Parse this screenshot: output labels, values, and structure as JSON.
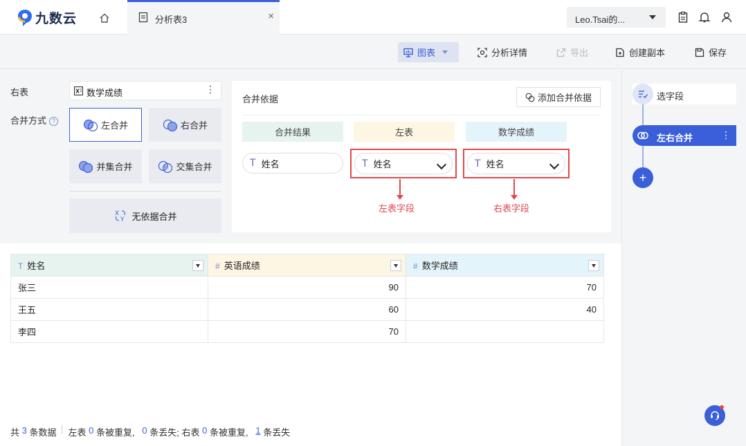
{
  "app": {
    "logo_text": "九数云",
    "tab_title": "分析表3",
    "tab_close": "×",
    "user_label": "Leo.Tsai的..."
  },
  "toolbar": {
    "chart": "图表",
    "analysis_detail": "分析详情",
    "export": "导出",
    "create_copy": "创建副本",
    "save": "保存"
  },
  "config": {
    "right_table_label": "右表",
    "right_table_value": "数学成绩",
    "right_table_more": "⋮",
    "merge_mode_label": "合并方式",
    "help_glyph": "?",
    "modes": [
      "左合并",
      "右合并",
      "并集合并",
      "交集合并"
    ],
    "selected_mode": "左合并",
    "no_basis": "无依据合并"
  },
  "merge_basis": {
    "title": "合并依据",
    "add_button": "添加合并依据",
    "col_headers": [
      "合并结果",
      "左表",
      "数学成绩"
    ],
    "col_colors": [
      "#e6f3ee",
      "#fdf6e3",
      "#e4f4fb"
    ],
    "result_field": "姓名",
    "left_field": "姓名",
    "right_field": "姓名",
    "annot_left": "左表字段",
    "annot_right": "右表字段",
    "type_glyph": "T"
  },
  "table": {
    "columns": [
      {
        "type": "T",
        "name": "姓名",
        "bg": "#e6f3ee"
      },
      {
        "type": "#",
        "name": "英语成绩",
        "bg": "#fdf6e3"
      },
      {
        "type": "#",
        "name": "数学成绩",
        "bg": "#e4f4fb"
      }
    ],
    "rows": [
      [
        "张三",
        "90",
        "70"
      ],
      [
        "王五",
        "60",
        "40"
      ],
      [
        "李四",
        "70",
        ""
      ]
    ]
  },
  "footer": {
    "t1": "共 ",
    "total": "3",
    "t2": " 条数据",
    "t3": "左表 ",
    "left_dup": "0",
    "t4": " 条被重复,   ",
    "left_lost": "0",
    "t5": " 条丢失; 右表 ",
    "right_dup": "0",
    "t6": " 条被重复,   ",
    "right_lost": "1",
    "t7": " 条丢失"
  },
  "steps": {
    "step1": "选字段",
    "step2": "左右合并",
    "step2_more": "⋮",
    "add": "+"
  },
  "colors": {
    "accent": "#3a5fd9",
    "annotation_red": "#e2474b"
  }
}
